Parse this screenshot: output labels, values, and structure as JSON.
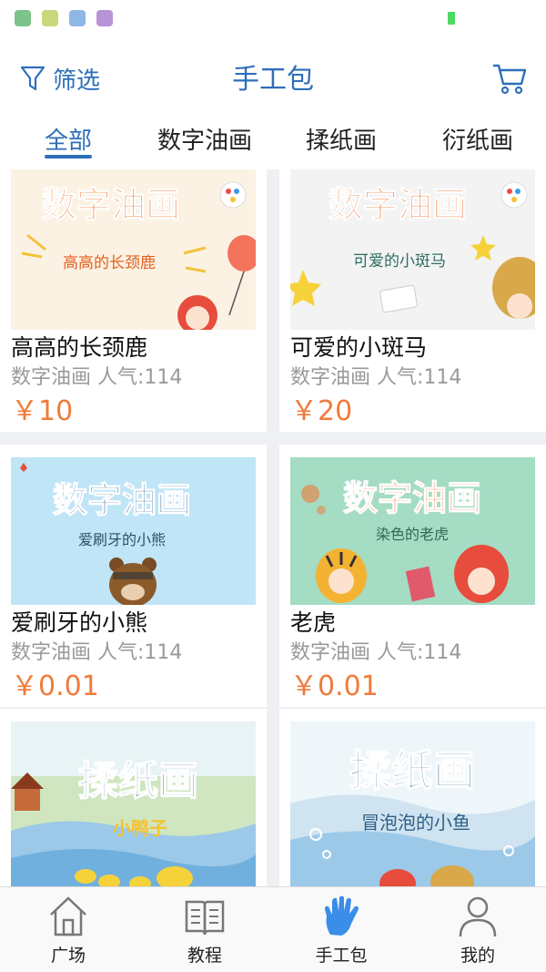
{
  "header": {
    "filter_label": "筛选",
    "title": "手工包"
  },
  "tabs": [
    {
      "label": "全部",
      "active": true
    },
    {
      "label": "数字油画"
    },
    {
      "label": "揉纸画"
    },
    {
      "label": "衍纸画"
    }
  ],
  "products": [
    {
      "banner": "数字油画",
      "subtitle": "高高的长颈鹿",
      "title": "高高的长颈鹿",
      "meta": "数字油画 人气:114",
      "price": "￥10",
      "bg": "#fbf2e4",
      "banner_color": "#f07b3a"
    },
    {
      "banner": "数字油画",
      "subtitle": "可爱的小斑马",
      "title": "可爱的小斑马",
      "meta": "数字油画 人气:114",
      "price": "￥20",
      "bg": "#f3f3f3",
      "banner_color": "#f07b3a"
    },
    {
      "banner": "数字油画",
      "subtitle": "爱刷牙的小熊",
      "title": "爱刷牙的小熊",
      "meta": "数字油画 人气:114",
      "price": "￥0.01",
      "bg": "#bfe5f7",
      "banner_color": "#2f5f86"
    },
    {
      "banner": "数字油画",
      "subtitle": "染色的老虎",
      "title": "老虎",
      "meta": "数字油画 人气:114",
      "price": "￥0.01",
      "bg": "#a4dcc4",
      "banner_color": "#f07b3a"
    },
    {
      "banner": "揉纸画",
      "subtitle": "小鸭子",
      "title": "",
      "meta": "",
      "price": "",
      "bg": "#d9ecd0",
      "banner_color": "#3a6f9a"
    },
    {
      "banner": "揉纸画",
      "subtitle": "冒泡泡的小鱼",
      "title": "",
      "meta": "",
      "price": "",
      "bg": "#cfe3f1",
      "banner_color": "#3a6f9a"
    }
  ],
  "bottom_nav": [
    {
      "label": "广场",
      "icon": "house-icon"
    },
    {
      "label": "教程",
      "icon": "book-icon"
    },
    {
      "label": "手工包",
      "icon": "hand-icon",
      "active": true
    },
    {
      "label": "我的",
      "icon": "person-icon"
    }
  ],
  "colors": {
    "accent": "#2e6fb8",
    "price": "#f07b3a"
  }
}
